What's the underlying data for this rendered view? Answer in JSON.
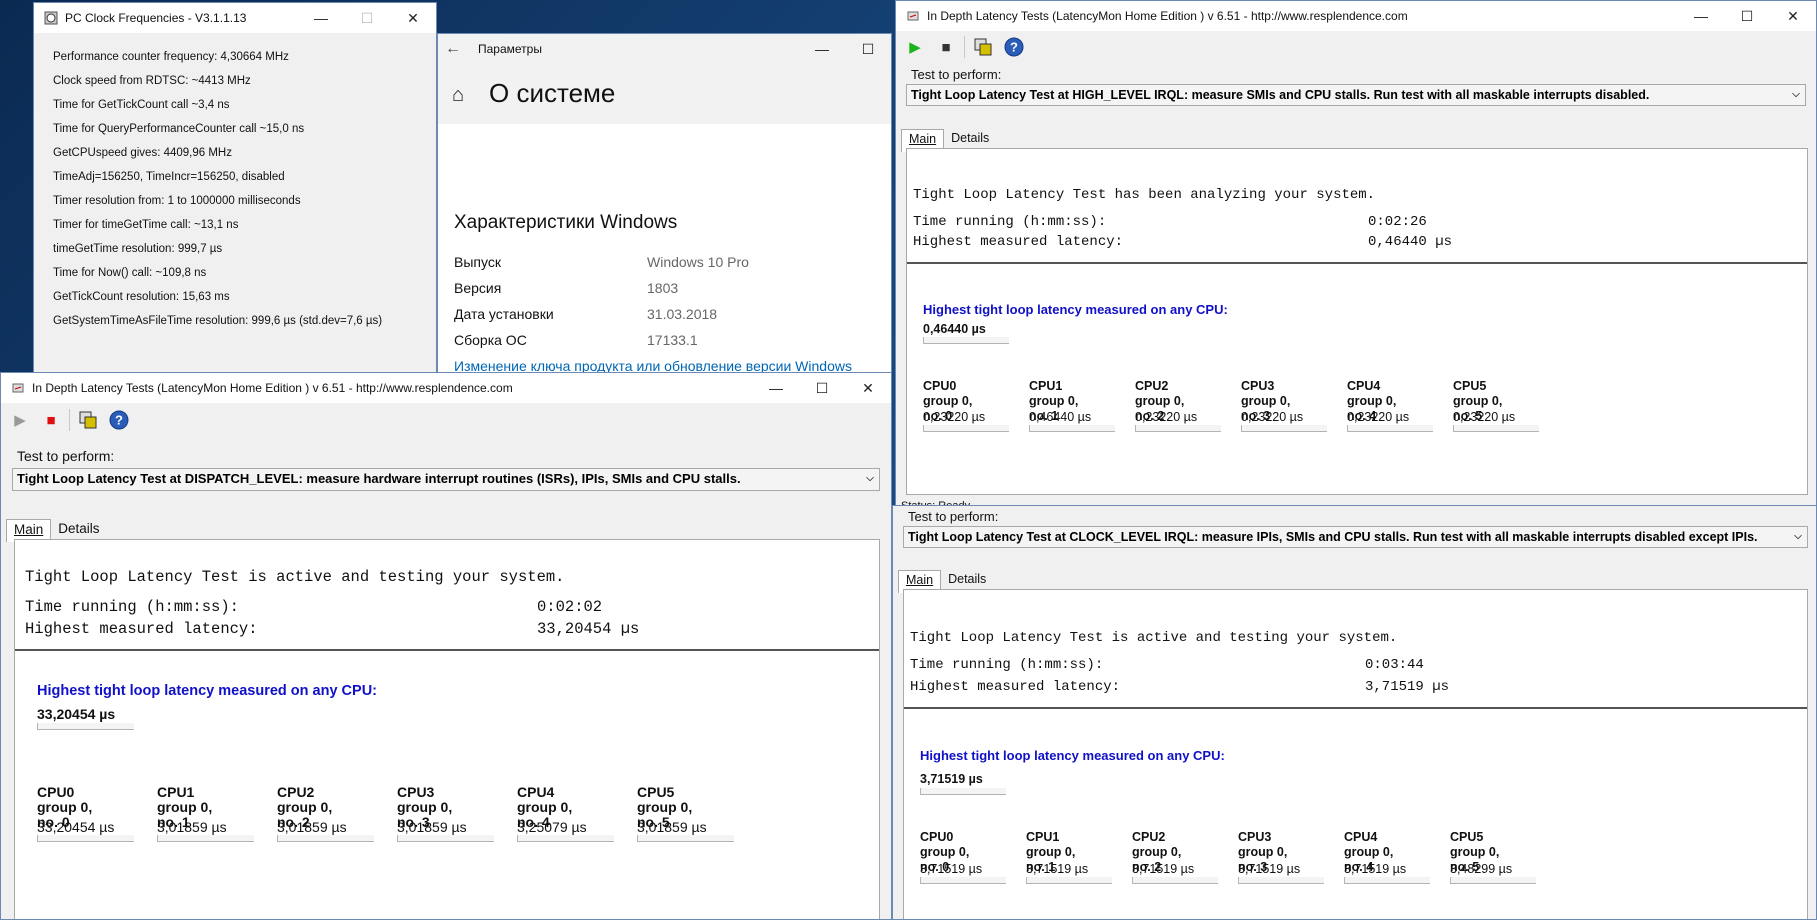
{
  "pc_clock": {
    "title": "PC Clock Frequencies - V3.1.1.13",
    "lines": [
      "Performance counter frequency: 4,30664 MHz",
      "Clock speed from RDTSC: ~4413 MHz",
      "Time for GetTickCount call ~3,4 ns",
      "Time for QueryPerformanceCounter call ~15,0 ns",
      "GetCPUspeed gives: 4409,96 MHz",
      "TimeAdj=156250, TimeIncr=156250, disabled",
      "Timer resolution from: 1 to 1000000 milliseconds",
      "Timer for timeGetTime call: ~13,1 ns",
      "timeGetTime resolution: 999,7 µs",
      "Time for Now() call: ~109,8 ns",
      "GetTickCount resolution: 15,63 ms",
      "GetSystemTimeAsFileTime resolution: 999,6 µs  (std.dev=7,6 µs)"
    ]
  },
  "settings": {
    "window_title": "Параметры",
    "page_title": "О системе",
    "section_title": "Характеристики Windows",
    "rows": [
      {
        "key": "Выпуск",
        "value": "Windows 10 Pro"
      },
      {
        "key": "Версия",
        "value": "1803"
      },
      {
        "key": "Дата установки",
        "value": "31.03.2018"
      },
      {
        "key": "Сборка ОС",
        "value": "17133.1"
      }
    ],
    "link": "Изменение ключа продукта или обновление версии Windows"
  },
  "common": {
    "lm_title": "In Depth Latency Tests  (LatencyMon Home Edition )  v 6.51 - http://www.resplendence.com",
    "test_to_perform": "Test to perform:",
    "tab_main": "Main",
    "tab_details": "Details",
    "time_running_label": "Time running (h:mm:ss):",
    "highest_label": "Highest measured latency:",
    "cpu_highest_title": "Highest tight loop latency measured on any CPU:",
    "group_label": "group 0,",
    "cpu_names": [
      "CPU0",
      "CPU1",
      "CPU2",
      "CPU3",
      "CPU4",
      "CPU5"
    ],
    "cpu_nos": [
      "no. 0",
      "no. 1",
      "no. 2",
      "no. 3",
      "no. 4",
      "no. 5"
    ],
    "status_ready": "Status: Ready"
  },
  "lm_high": {
    "test": "Tight Loop Latency Test at HIGH_LEVEL IRQL:  measure SMIs and CPU stalls. Run test with all maskable interrupts disabled.",
    "status_msg": "Tight Loop Latency Test has been analyzing your system.",
    "time_running": "0:02:26",
    "highest": "0,46440 µs",
    "cpu_values": [
      "0,23220 µs",
      "0,46440 µs",
      "0,23220 µs",
      "0,23220 µs",
      "0,23220 µs",
      "0,23220 µs"
    ]
  },
  "lm_dispatch": {
    "test": "Tight Loop Latency Test at DISPATCH_LEVEL:  measure hardware interrupt routines (ISRs), IPIs, SMIs and CPU stalls.",
    "status_msg": "Tight Loop Latency Test is active and testing your system.",
    "time_running": "0:02:02",
    "highest": "33,20454 µs",
    "cpu_values": [
      "33,20454 µs",
      "3,01859 µs",
      "3,01859 µs",
      "3,01859 µs",
      "3,25079 µs",
      "3,01859 µs"
    ]
  },
  "lm_clock": {
    "test": "Tight Loop Latency Test at CLOCK_LEVEL IRQL: measure IPIs, SMIs and CPU stalls. Run test with all maskable interrupts disabled except IPIs.",
    "status_msg": "Tight Loop Latency Test is active and testing your system.",
    "time_running": "0:03:44",
    "highest": "3,71519 µs",
    "cpu_values": [
      "3,71519 µs",
      "3,71519 µs",
      "3,71519 µs",
      "3,71519 µs",
      "3,71519 µs",
      "3,48299 µs"
    ]
  },
  "colors": {
    "accent_blue": "#1010c8",
    "link_blue": "#0066b4"
  }
}
